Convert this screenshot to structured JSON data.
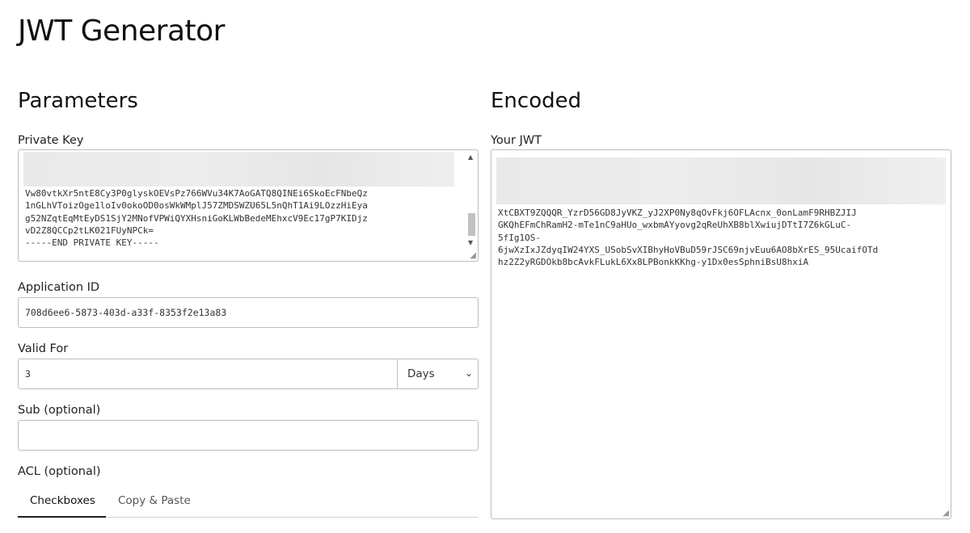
{
  "page": {
    "title": "JWT Generator"
  },
  "parameters": {
    "heading": "Parameters",
    "private_key": {
      "label": "Private Key",
      "visible_text": "Vw80vtkXr5ntE8Cy3P0glyskOEVsPz766WVu34K7AoGATQ8QINEi6SkoEcFNbeQz\n1nGLhVToizOge1loIv0okoOD0osWkWMplJ57ZMDSWZU65L5nQhT1Ai9LOzzHiEya\ng52NZqtEqMtEyDS1SjY2MNofVPWiQYXHsniGoKLWbBedeMEhxcV9Ec17gP7KIDjz\nvD2Z8QCCp2tLK021FUyNPCk=\n-----END PRIVATE KEY-----"
    },
    "application_id": {
      "label": "Application ID",
      "value": "708d6ee6-5873-403d-a33f-8353f2e13a83"
    },
    "valid_for": {
      "label": "Valid For",
      "value": "3",
      "unit": "Days"
    },
    "sub": {
      "label": "Sub (optional)",
      "value": ""
    },
    "acl": {
      "label": "ACL (optional)",
      "tabs": [
        {
          "label": "Checkboxes",
          "active": true
        },
        {
          "label": "Copy & Paste",
          "active": false
        }
      ]
    }
  },
  "encoded": {
    "heading": "Encoded",
    "jwt_label": "Your JWT",
    "jwt_visible_text": "XtCBXT9ZQQQR_YzrD56GD8JyVKZ_yJ2XP0Ny8qOvFkj6OFLAcnx_0onLamF9RHBZJIJ\nGKQhEFmChRamH2-mTe1nC9aHUo_wxbmAYyovg2qReUhXB8blXwiujDTtI7Z6kGLuC-\n5fIg1OS-\n6jwXzIxJZdyqIW24YXS_USobSvXIBhyHoVBuD59rJSC69njvEuu6AO8bXrES_95UcaifOTd\nhz2Z2yRGDOkb8bcAvkFLukL6Xx8LPBonkKKhg-y1Dx0esSphniBsU8hxiA"
  },
  "colors": {
    "tab_underline": "#1f1f1f",
    "border": "#bdbdbd",
    "blur": "#e9e9e9"
  }
}
